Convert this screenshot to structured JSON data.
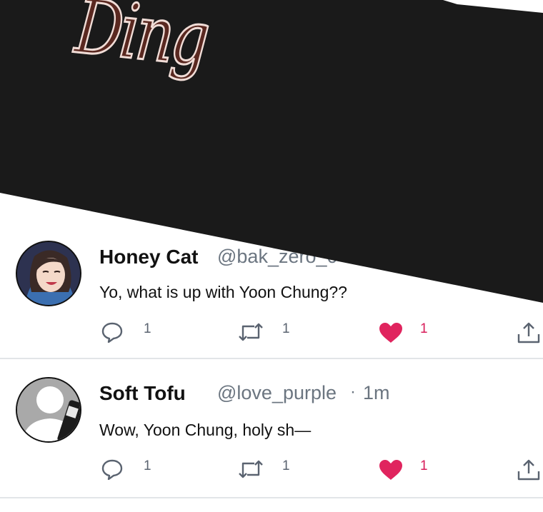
{
  "banner": {
    "title": "Ding",
    "background": "#1a1a1a",
    "title_color": "#5a2820"
  },
  "colors": {
    "like": "#e0245e",
    "secondary_text": "#6b7580",
    "divider": "#e2e5e8"
  },
  "tweets": [
    {
      "name": "Honey Cat",
      "handle": "@bak_zero_0",
      "text": "Yo, what is up with Yoon Chung??",
      "avatar": "illustrated-character-avatar",
      "replies": "1",
      "retweets": "1",
      "likes": "1",
      "liked": true
    },
    {
      "name": "Soft Tofu",
      "handle": "@love_purple",
      "separator": "·",
      "time": "1m",
      "text": "Wow, Yoon Chung, holy sh—",
      "avatar": "default-person-avatar",
      "replies": "1",
      "retweets": "1",
      "likes": "1",
      "liked": true
    }
  ],
  "icons": {
    "reply": "speech-bubble-icon",
    "retweet": "retweet-arrows-icon",
    "like": "heart-icon",
    "share": "share-upload-icon"
  }
}
